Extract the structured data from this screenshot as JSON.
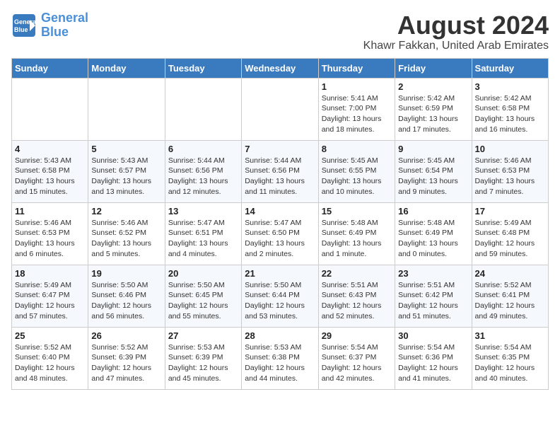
{
  "header": {
    "logo_line1": "General",
    "logo_line2": "Blue",
    "month_year": "August 2024",
    "location": "Khawr Fakkan, United Arab Emirates"
  },
  "weekdays": [
    "Sunday",
    "Monday",
    "Tuesday",
    "Wednesday",
    "Thursday",
    "Friday",
    "Saturday"
  ],
  "weeks": [
    [
      {
        "day": "",
        "info": ""
      },
      {
        "day": "",
        "info": ""
      },
      {
        "day": "",
        "info": ""
      },
      {
        "day": "",
        "info": ""
      },
      {
        "day": "1",
        "info": "Sunrise: 5:41 AM\nSunset: 7:00 PM\nDaylight: 13 hours\nand 18 minutes."
      },
      {
        "day": "2",
        "info": "Sunrise: 5:42 AM\nSunset: 6:59 PM\nDaylight: 13 hours\nand 17 minutes."
      },
      {
        "day": "3",
        "info": "Sunrise: 5:42 AM\nSunset: 6:58 PM\nDaylight: 13 hours\nand 16 minutes."
      }
    ],
    [
      {
        "day": "4",
        "info": "Sunrise: 5:43 AM\nSunset: 6:58 PM\nDaylight: 13 hours\nand 15 minutes."
      },
      {
        "day": "5",
        "info": "Sunrise: 5:43 AM\nSunset: 6:57 PM\nDaylight: 13 hours\nand 13 minutes."
      },
      {
        "day": "6",
        "info": "Sunrise: 5:44 AM\nSunset: 6:56 PM\nDaylight: 13 hours\nand 12 minutes."
      },
      {
        "day": "7",
        "info": "Sunrise: 5:44 AM\nSunset: 6:56 PM\nDaylight: 13 hours\nand 11 minutes."
      },
      {
        "day": "8",
        "info": "Sunrise: 5:45 AM\nSunset: 6:55 PM\nDaylight: 13 hours\nand 10 minutes."
      },
      {
        "day": "9",
        "info": "Sunrise: 5:45 AM\nSunset: 6:54 PM\nDaylight: 13 hours\nand 9 minutes."
      },
      {
        "day": "10",
        "info": "Sunrise: 5:46 AM\nSunset: 6:53 PM\nDaylight: 13 hours\nand 7 minutes."
      }
    ],
    [
      {
        "day": "11",
        "info": "Sunrise: 5:46 AM\nSunset: 6:53 PM\nDaylight: 13 hours\nand 6 minutes."
      },
      {
        "day": "12",
        "info": "Sunrise: 5:46 AM\nSunset: 6:52 PM\nDaylight: 13 hours\nand 5 minutes."
      },
      {
        "day": "13",
        "info": "Sunrise: 5:47 AM\nSunset: 6:51 PM\nDaylight: 13 hours\nand 4 minutes."
      },
      {
        "day": "14",
        "info": "Sunrise: 5:47 AM\nSunset: 6:50 PM\nDaylight: 13 hours\nand 2 minutes."
      },
      {
        "day": "15",
        "info": "Sunrise: 5:48 AM\nSunset: 6:49 PM\nDaylight: 13 hours\nand 1 minute."
      },
      {
        "day": "16",
        "info": "Sunrise: 5:48 AM\nSunset: 6:49 PM\nDaylight: 13 hours\nand 0 minutes."
      },
      {
        "day": "17",
        "info": "Sunrise: 5:49 AM\nSunset: 6:48 PM\nDaylight: 12 hours\nand 59 minutes."
      }
    ],
    [
      {
        "day": "18",
        "info": "Sunrise: 5:49 AM\nSunset: 6:47 PM\nDaylight: 12 hours\nand 57 minutes."
      },
      {
        "day": "19",
        "info": "Sunrise: 5:50 AM\nSunset: 6:46 PM\nDaylight: 12 hours\nand 56 minutes."
      },
      {
        "day": "20",
        "info": "Sunrise: 5:50 AM\nSunset: 6:45 PM\nDaylight: 12 hours\nand 55 minutes."
      },
      {
        "day": "21",
        "info": "Sunrise: 5:50 AM\nSunset: 6:44 PM\nDaylight: 12 hours\nand 53 minutes."
      },
      {
        "day": "22",
        "info": "Sunrise: 5:51 AM\nSunset: 6:43 PM\nDaylight: 12 hours\nand 52 minutes."
      },
      {
        "day": "23",
        "info": "Sunrise: 5:51 AM\nSunset: 6:42 PM\nDaylight: 12 hours\nand 51 minutes."
      },
      {
        "day": "24",
        "info": "Sunrise: 5:52 AM\nSunset: 6:41 PM\nDaylight: 12 hours\nand 49 minutes."
      }
    ],
    [
      {
        "day": "25",
        "info": "Sunrise: 5:52 AM\nSunset: 6:40 PM\nDaylight: 12 hours\nand 48 minutes."
      },
      {
        "day": "26",
        "info": "Sunrise: 5:52 AM\nSunset: 6:39 PM\nDaylight: 12 hours\nand 47 minutes."
      },
      {
        "day": "27",
        "info": "Sunrise: 5:53 AM\nSunset: 6:39 PM\nDaylight: 12 hours\nand 45 minutes."
      },
      {
        "day": "28",
        "info": "Sunrise: 5:53 AM\nSunset: 6:38 PM\nDaylight: 12 hours\nand 44 minutes."
      },
      {
        "day": "29",
        "info": "Sunrise: 5:54 AM\nSunset: 6:37 PM\nDaylight: 12 hours\nand 42 minutes."
      },
      {
        "day": "30",
        "info": "Sunrise: 5:54 AM\nSunset: 6:36 PM\nDaylight: 12 hours\nand 41 minutes."
      },
      {
        "day": "31",
        "info": "Sunrise: 5:54 AM\nSunset: 6:35 PM\nDaylight: 12 hours\nand 40 minutes."
      }
    ]
  ]
}
